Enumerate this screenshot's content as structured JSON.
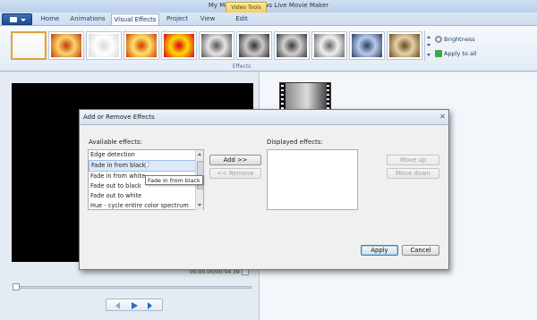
{
  "window": {
    "title": "My Movie - Windows Live Movie Maker",
    "contextual_tab_group": "Video Tools"
  },
  "ribbon": {
    "tabs": [
      {
        "label": "Home"
      },
      {
        "label": "Animations"
      },
      {
        "label": "Visual Effects",
        "active": true
      },
      {
        "label": "Project"
      },
      {
        "label": "View"
      },
      {
        "label": "Edit"
      }
    ],
    "group_label": "Effects",
    "effect_thumbnails": [
      {
        "icon": "no-effect",
        "selected": true,
        "colors": [
          "#ffffff",
          "#f4f4f4"
        ]
      },
      {
        "icon": "flower-warm",
        "colors": [
          "#fbd56b",
          "#c33a0a"
        ]
      },
      {
        "icon": "flower-faded",
        "colors": [
          "#ffffff",
          "#d9d9d9"
        ]
      },
      {
        "icon": "flower-orange",
        "colors": [
          "#ffe36b",
          "#d13c00"
        ]
      },
      {
        "icon": "flower-red",
        "colors": [
          "#ffdc00",
          "#d8001c"
        ]
      },
      {
        "icon": "flower-gray",
        "colors": [
          "#e6e6e6",
          "#555555"
        ]
      },
      {
        "icon": "flower-gray-dark",
        "colors": [
          "#c9c9c9",
          "#333333"
        ]
      },
      {
        "icon": "flower-gray-edge",
        "colors": [
          "#d0d0d0",
          "#3a3a3a"
        ]
      },
      {
        "icon": "flower-gray-light",
        "colors": [
          "#f0f0f0",
          "#666666"
        ]
      },
      {
        "icon": "flower-blue",
        "colors": [
          "#b9cbe8",
          "#2a3f6a"
        ]
      },
      {
        "icon": "flower-sepia",
        "colors": [
          "#e6d2a8",
          "#6a4a22"
        ]
      }
    ],
    "brightness_label": "Brightness",
    "apply_all_label": "Apply to all"
  },
  "preview": {
    "time_readout": "00:00.00/00:04.39"
  },
  "dialog": {
    "title": "Add or Remove Effects",
    "available_label": "Available effects:",
    "displayed_label": "Displayed effects:",
    "available_effects": [
      "Edge detection",
      "Fade in from black",
      "Fade in from white",
      "Fade out to black",
      "Fade out to white",
      "Hue - cycle entire color spectrum"
    ],
    "selected_index": 1,
    "tooltip": "Fade in from black",
    "add_button": "Add >>",
    "remove_button": "<< Remove",
    "move_up_button": "Move up",
    "move_down_button": "Move down",
    "apply_button": "Apply",
    "cancel_button": "Cancel"
  },
  "colors": {
    "accent": "#e0a23c",
    "ribbon_border": "#9fb6d3"
  }
}
